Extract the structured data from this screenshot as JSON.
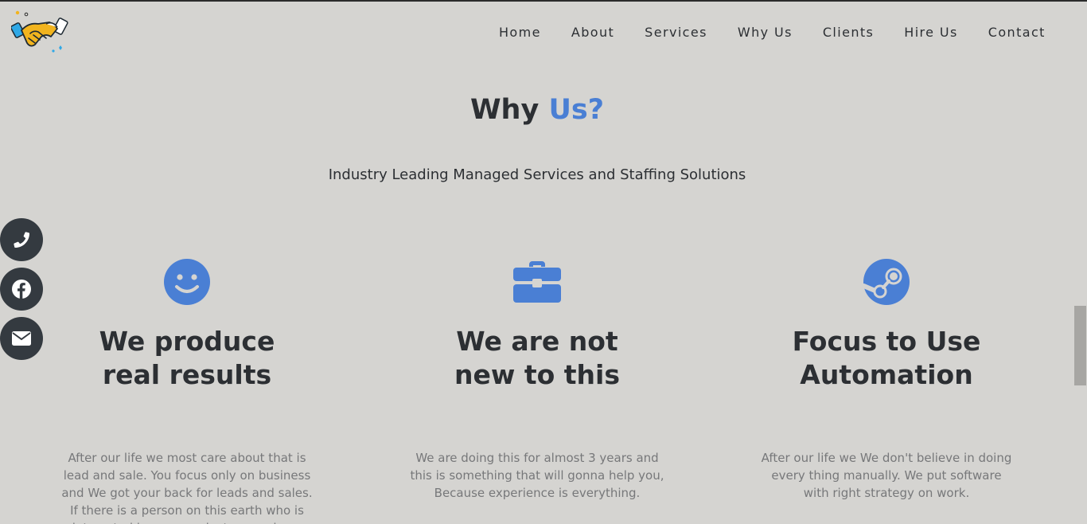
{
  "brand": {
    "logo_icon": "handshake-icon"
  },
  "nav": {
    "items": [
      {
        "label": "Home"
      },
      {
        "label": "About"
      },
      {
        "label": "Services"
      },
      {
        "label": "Why Us"
      },
      {
        "label": "Clients"
      },
      {
        "label": "Hire Us"
      },
      {
        "label": "Contact"
      }
    ]
  },
  "section": {
    "title_main": "Why",
    "title_accent": "Us?",
    "subtitle": "Industry Leading Managed Services and Staffing Solutions"
  },
  "social": [
    {
      "icon": "phone-icon"
    },
    {
      "icon": "facebook-icon"
    },
    {
      "icon": "envelope-icon"
    }
  ],
  "features": [
    {
      "icon": "smile-icon",
      "title_line1": "We produce",
      "title_line2": "real results",
      "text": "After our life we most care about that is lead and sale. You focus only on business and We got your back for leads and sales. If there is a person on this earth who is interested in your product or service..."
    },
    {
      "icon": "briefcase-icon",
      "title_line1": "We are not",
      "title_line2": "new to this",
      "text": "We are doing this for almost 3 years and this is something that will gonna help you, Because experience is everything."
    },
    {
      "icon": "steam-icon",
      "title_line1": "Focus to Use",
      "title_line2": "Automation",
      "text": "After our life we We don't believe in doing every thing manually. We put software with right strategy on work."
    }
  ],
  "colors": {
    "accent": "#4a7fd4",
    "background": "#d5d4d1",
    "text_dark": "#2c2f33",
    "text_muted": "#77787a",
    "social_bg": "#343a40"
  }
}
